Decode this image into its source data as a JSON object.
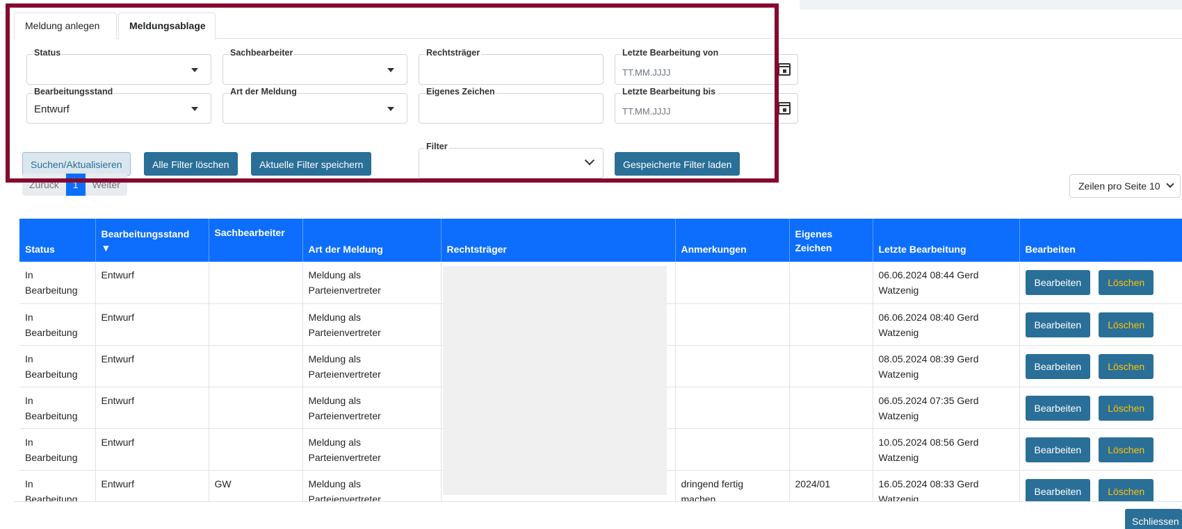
{
  "tabs": [
    {
      "label": "Meldung anlegen"
    },
    {
      "label": "Meldungsablage"
    }
  ],
  "filters": {
    "status": {
      "label": "Status",
      "value": ""
    },
    "sachbearbeiter": {
      "label": "Sachbearbeiter",
      "value": ""
    },
    "rechtstraeger": {
      "label": "Rechtsträger",
      "value": ""
    },
    "letzte_von": {
      "label": "Letzte Bearbeitung von",
      "placeholder": "TT.MM.JJJJ"
    },
    "bearbeitungsstand": {
      "label": "Bearbeitungsstand",
      "value": "Entwurf"
    },
    "art": {
      "label": "Art der Meldung",
      "value": ""
    },
    "eigenes_zeichen": {
      "label": "Eigenes Zeichen",
      "value": ""
    },
    "letzte_bis": {
      "label": "Letzte Bearbeitung bis",
      "placeholder": "TT.MM.JJJJ"
    },
    "filter": {
      "label": "Filter",
      "value": ""
    }
  },
  "buttons": {
    "search": "Suchen/Aktualisieren",
    "clear": "Alle Filter löschen",
    "save": "Aktuelle Filter speichern",
    "load": "Gespeicherte Filter laden",
    "close": "Schliessen"
  },
  "pagination": {
    "prev": "Zurück",
    "current": "1",
    "next": "Weiter"
  },
  "rows_per_page": "Zeilen pro Seite 10",
  "table": {
    "headers": {
      "status": "Status",
      "stand": "Bearbeitungsstand",
      "stand_sort": "▼",
      "sb": "Sachbearbeiter",
      "art": "Art der Meldung",
      "rt": "Rechtsträger",
      "anm": "Anmerkungen",
      "ez_1": "Eigenes",
      "ez_2": "Zeichen",
      "lb": "Letzte Bearbeitung",
      "actions": "Bearbeiten"
    },
    "edit_label": "Bearbeiten",
    "delete_label": "Löschen",
    "rows": [
      {
        "status_1": "In",
        "status_2": "Bearbeitung",
        "stand": "Entwurf",
        "sb": "",
        "art_1": "Meldung als",
        "art_2": "Parteienvertreter",
        "anm_1": "",
        "anm_2": "",
        "ez": "",
        "lb_1": "06.06.2024 08:44 Gerd",
        "lb_2": "Watzenig"
      },
      {
        "status_1": "In",
        "status_2": "Bearbeitung",
        "stand": "Entwurf",
        "sb": "",
        "art_1": "Meldung als",
        "art_2": "Parteienvertreter",
        "anm_1": "",
        "anm_2": "",
        "ez": "",
        "lb_1": "06.06.2024 08:40 Gerd",
        "lb_2": "Watzenig"
      },
      {
        "status_1": "In",
        "status_2": "Bearbeitung",
        "stand": "Entwurf",
        "sb": "",
        "art_1": "Meldung als",
        "art_2": "Parteienvertreter",
        "anm_1": "",
        "anm_2": "",
        "ez": "",
        "lb_1": "08.05.2024 08:39 Gerd",
        "lb_2": "Watzenig"
      },
      {
        "status_1": "In",
        "status_2": "Bearbeitung",
        "stand": "Entwurf",
        "sb": "",
        "art_1": "Meldung als",
        "art_2": "Parteienvertreter",
        "anm_1": "",
        "anm_2": "",
        "ez": "",
        "lb_1": "06.05.2024 07:35 Gerd",
        "lb_2": "Watzenig"
      },
      {
        "status_1": "In",
        "status_2": "Bearbeitung",
        "stand": "Entwurf",
        "sb": "",
        "art_1": "Meldung als",
        "art_2": "Parteienvertreter",
        "anm_1": "",
        "anm_2": "",
        "ez": "",
        "lb_1": "10.05.2024 08:56 Gerd",
        "lb_2": "Watzenig"
      },
      {
        "status_1": "In",
        "status_2": "Bearbeitung",
        "stand": "Entwurf",
        "sb": "GW",
        "art_1": "Meldung als",
        "art_2": "Parteienvertreter",
        "anm_1": "dringend fertig",
        "anm_2": "machen",
        "ez": "2024/01",
        "lb_1": "16.05.2024 08:33 Gerd",
        "lb_2": "Watzenig"
      }
    ]
  },
  "colors": {
    "header_blue": "#0d6efd",
    "button_blue": "#2a6f97",
    "delete_text": "#ffc107",
    "highlight_frame": "#85082f"
  }
}
